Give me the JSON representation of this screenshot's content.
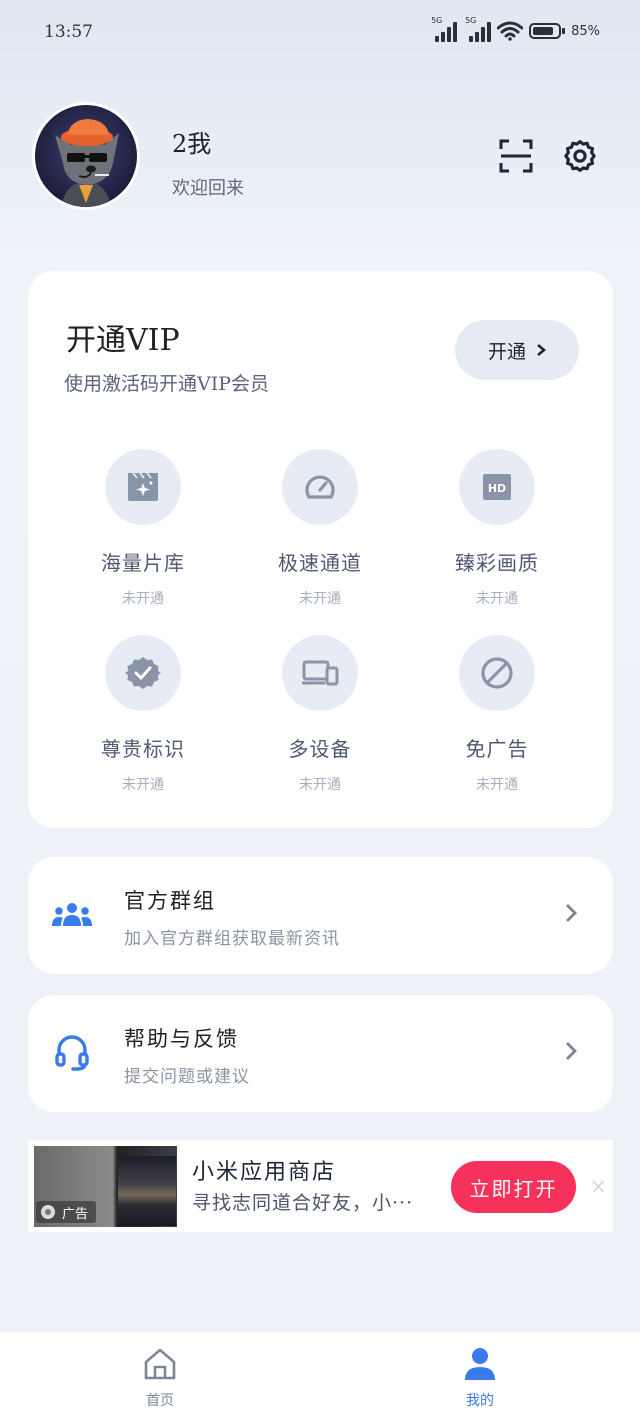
{
  "status_bar": {
    "time": "13:57",
    "signal1_label": "5G",
    "signal2_label": "5G",
    "battery": "85%"
  },
  "profile": {
    "username": "2我",
    "welcome": "欢迎回来",
    "scan_icon": "scan-icon",
    "settings_icon": "gear-icon"
  },
  "vip": {
    "title": "开通VIP",
    "subtitle": "使用激活码开通VIP会员",
    "open_button": "开通",
    "features": [
      {
        "name": "海量片库",
        "status": "未开通",
        "icon": "film-library-icon"
      },
      {
        "name": "极速通道",
        "status": "未开通",
        "icon": "speedometer-icon"
      },
      {
        "name": "臻彩画质",
        "status": "未开通",
        "icon": "hd-icon"
      },
      {
        "name": "尊贵标识",
        "status": "未开通",
        "icon": "verified-badge-icon"
      },
      {
        "name": "多设备",
        "status": "未开通",
        "icon": "multi-device-icon"
      },
      {
        "name": "免广告",
        "status": "未开通",
        "icon": "no-ads-icon"
      }
    ]
  },
  "menu": [
    {
      "title": "官方群组",
      "subtitle": "加入官方群组获取最新资讯",
      "icon": "group-icon"
    },
    {
      "title": "帮助与反馈",
      "subtitle": "提交问题或建议",
      "icon": "headset-icon"
    }
  ],
  "ad": {
    "badge": "广告",
    "title": "小米应用商店",
    "description": "寻找志同道合好友，小···",
    "button": "立即打开",
    "close": "×"
  },
  "tabbar": {
    "items": [
      {
        "label": "首页",
        "icon": "home-icon",
        "active": false
      },
      {
        "label": "我的",
        "icon": "user-icon",
        "active": true
      }
    ]
  },
  "colors": {
    "accent_blue": "#3a7bea",
    "ad_button": "#f6325a",
    "icon_gray": "#8a94a8"
  }
}
